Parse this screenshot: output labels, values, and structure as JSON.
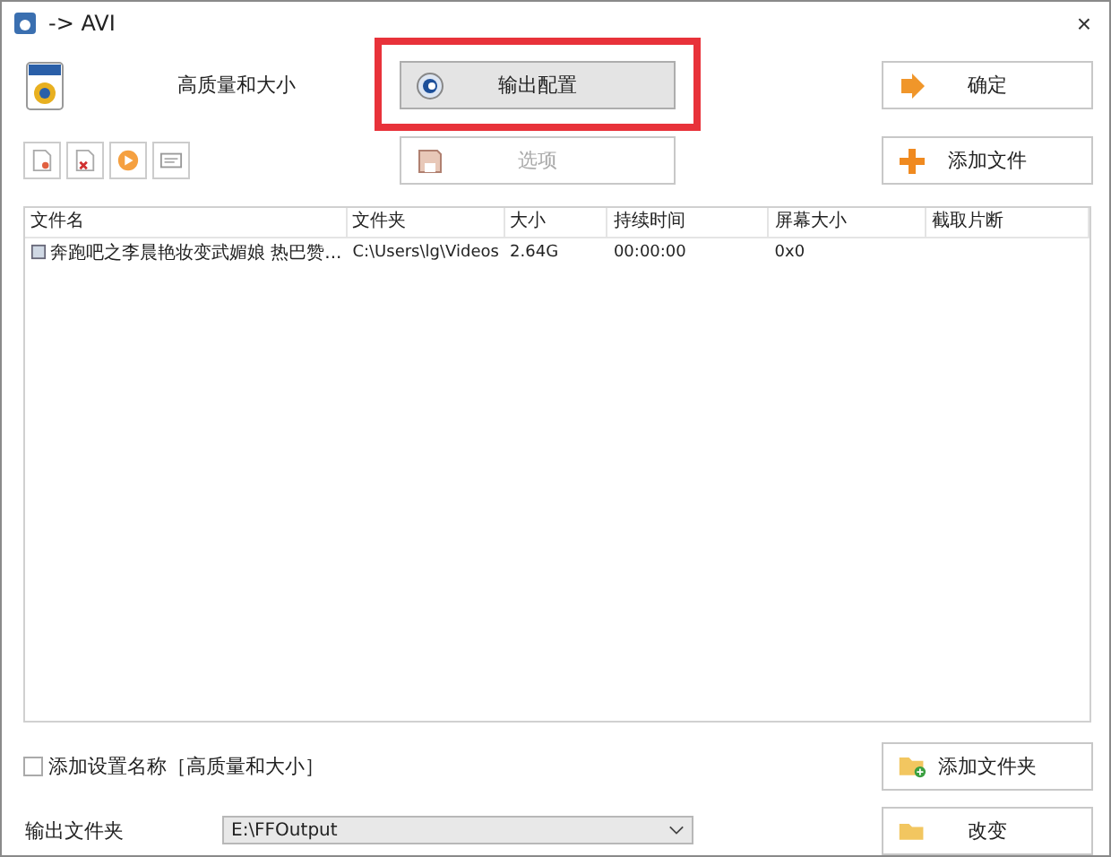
{
  "window": {
    "title": "-> AVI",
    "close": "×"
  },
  "preset": "高质量和大小",
  "output_config_button": {
    "label": "输出配置",
    "highlighted": true
  },
  "options_button": {
    "label": "选项",
    "disabled": true
  },
  "ok_button": "确定",
  "add_file_button": "添加文件",
  "table": {
    "columns": [
      "文件名",
      "文件夹",
      "大小",
      "持续时间",
      "屏幕大小",
      "截取片断"
    ],
    "rows": [
      {
        "cells": [
          "奔跑吧之李晨艳妆变武媚娘 热巴赞...",
          "C:\\Users\\lg\\Videos",
          "2.64G",
          "00:00:00",
          "0x0",
          ""
        ]
      }
    ]
  },
  "add_setting_name": {
    "label": "添加设置名称［高质量和大小］",
    "checked": false
  },
  "add_folder_button": "添加文件夹",
  "output_folder": {
    "label": "输出文件夹",
    "value": "E:\\FFOutput"
  },
  "change_button": "改变"
}
